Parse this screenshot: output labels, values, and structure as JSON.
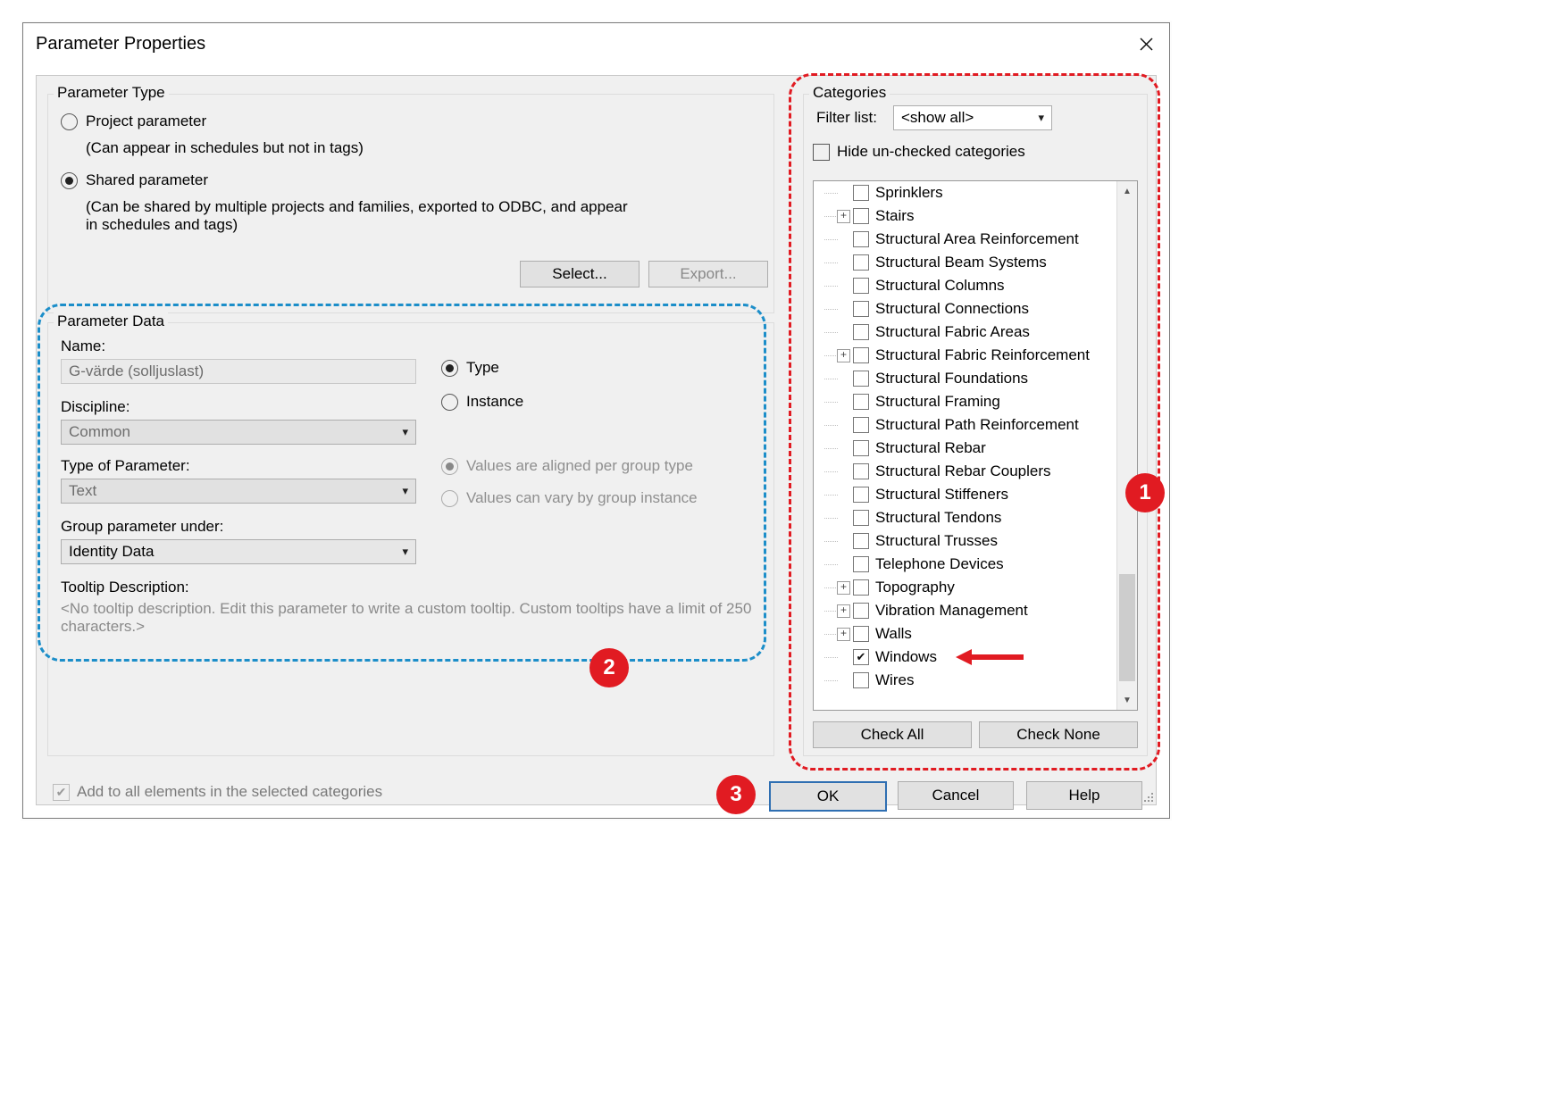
{
  "window": {
    "title": "Parameter Properties"
  },
  "ptype": {
    "legend": "Parameter Type",
    "project": {
      "label": "Project parameter",
      "sub": "(Can appear in schedules but not in tags)"
    },
    "shared": {
      "label": "Shared parameter",
      "sub": "(Can be shared by multiple projects and families, exported to ODBC, and appear in schedules and tags)"
    },
    "select": "Select...",
    "export": "Export..."
  },
  "pdata": {
    "legend": "Parameter Data",
    "name_label": "Name:",
    "name_value": "G-värde (solljuslast)",
    "discipline_label": "Discipline:",
    "discipline_value": "Common",
    "tparam_label": "Type of Parameter:",
    "tparam_value": "Text",
    "group_label": "Group parameter under:",
    "group_value": "Identity Data",
    "tooltip_label": "Tooltip Description:",
    "tooltip_placeholder": "<No tooltip description. Edit this parameter to write a custom tooltip. Custom tooltips have a limit of 250 characters.>",
    "type": "Type",
    "instance": "Instance",
    "aligned": "Values are aligned per group type",
    "vary": "Values can vary by group instance"
  },
  "footer": {
    "add_all": "Add to all elements in the selected categories",
    "ok": "OK",
    "cancel": "Cancel",
    "help": "Help"
  },
  "cats": {
    "legend": "Categories",
    "filter_label": "Filter list:",
    "filter_value": "<show all>",
    "hide_unchecked": "Hide un-checked categories",
    "check_all": "Check All",
    "check_none": "Check None",
    "items": [
      {
        "label": "Sprinklers",
        "expander": false,
        "indent": true,
        "checked": false
      },
      {
        "label": "Stairs",
        "expander": true,
        "indent": false,
        "checked": false
      },
      {
        "label": "Structural Area Reinforcement",
        "expander": false,
        "indent": true,
        "checked": false
      },
      {
        "label": "Structural Beam Systems",
        "expander": false,
        "indent": true,
        "checked": false
      },
      {
        "label": "Structural Columns",
        "expander": false,
        "indent": true,
        "checked": false
      },
      {
        "label": "Structural Connections",
        "expander": false,
        "indent": true,
        "checked": false
      },
      {
        "label": "Structural Fabric Areas",
        "expander": false,
        "indent": true,
        "checked": false
      },
      {
        "label": "Structural Fabric Reinforcement",
        "expander": true,
        "indent": false,
        "checked": false
      },
      {
        "label": "Structural Foundations",
        "expander": false,
        "indent": true,
        "checked": false
      },
      {
        "label": "Structural Framing",
        "expander": false,
        "indent": true,
        "checked": false
      },
      {
        "label": "Structural Path Reinforcement",
        "expander": false,
        "indent": true,
        "checked": false
      },
      {
        "label": "Structural Rebar",
        "expander": false,
        "indent": true,
        "checked": false
      },
      {
        "label": "Structural Rebar Couplers",
        "expander": false,
        "indent": true,
        "checked": false
      },
      {
        "label": "Structural Stiffeners",
        "expander": false,
        "indent": true,
        "checked": false
      },
      {
        "label": "Structural Tendons",
        "expander": false,
        "indent": true,
        "checked": false
      },
      {
        "label": "Structural Trusses",
        "expander": false,
        "indent": true,
        "checked": false
      },
      {
        "label": "Telephone Devices",
        "expander": false,
        "indent": true,
        "checked": false
      },
      {
        "label": "Topography",
        "expander": true,
        "indent": false,
        "checked": false
      },
      {
        "label": "Vibration Management",
        "expander": true,
        "indent": false,
        "checked": false
      },
      {
        "label": "Walls",
        "expander": true,
        "indent": false,
        "checked": false
      },
      {
        "label": "Windows",
        "expander": false,
        "indent": true,
        "checked": true
      },
      {
        "label": "Wires",
        "expander": false,
        "indent": true,
        "checked": false
      }
    ]
  },
  "annotations": {
    "c1": "1",
    "c2": "2",
    "c3": "3"
  }
}
